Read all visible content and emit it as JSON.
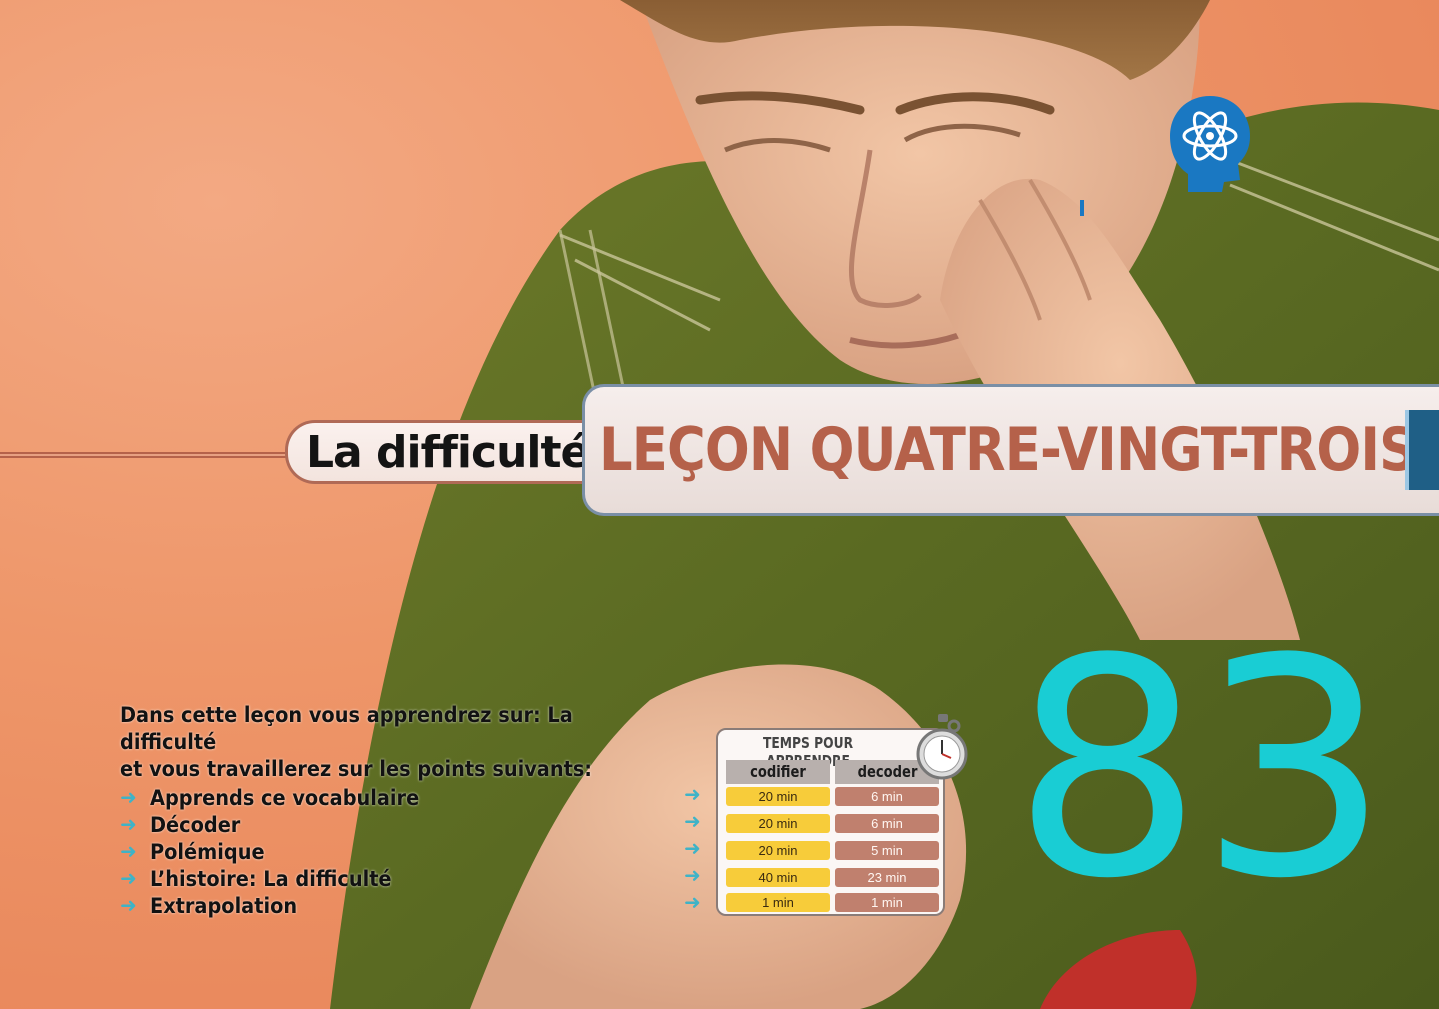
{
  "header": {
    "subject": "La difficulté",
    "lesson_title": "LEÇON QUATRE-VINGT-TROIS"
  },
  "lesson_number": "83",
  "intro": {
    "line1": "Dans cette leçon vous apprendrez sur: La difficulté",
    "line2": "et vous travaillerez sur les points suivants:"
  },
  "topics": [
    "Apprends ce vocabulaire",
    "Décoder",
    "Polémique",
    "L’histoire: La difficulté",
    "Extrapolation"
  ],
  "time_card": {
    "title": "TEMPS POUR APPRENDRE",
    "col1": "codifier",
    "col2": "decoder",
    "rows": [
      {
        "codifier": "20 min",
        "decoder": "6 min"
      },
      {
        "codifier": "20 min",
        "decoder": "6 min"
      },
      {
        "codifier": "20 min",
        "decoder": "5 min"
      },
      {
        "codifier": "40 min",
        "decoder": "23 min"
      },
      {
        "codifier": "1 min",
        "decoder": "1 min"
      }
    ]
  },
  "colors": {
    "background": "#ee9669",
    "accent_teal": "#19cdd4",
    "title_red": "#b5614a",
    "logo_blue": "#1a78c2"
  },
  "icons": [
    "atom-head-logo-icon",
    "arrow-right-icon",
    "stopwatch-icon"
  ]
}
